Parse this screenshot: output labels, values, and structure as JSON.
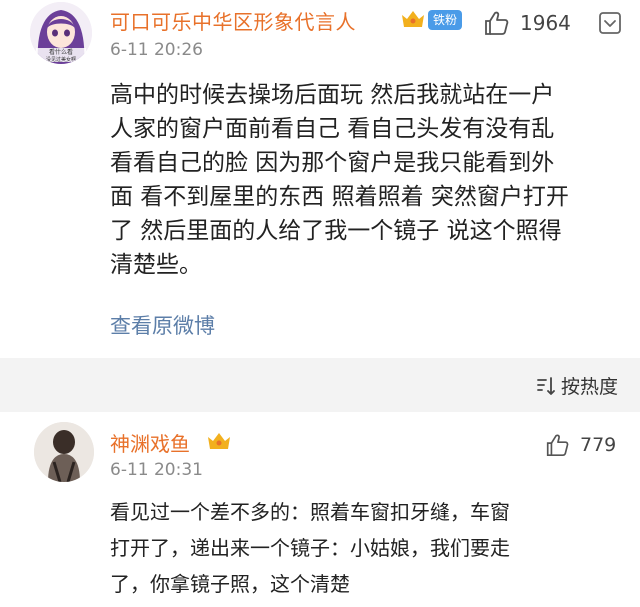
{
  "post": {
    "username": "可口可乐中华区形象代言人",
    "badge": "铁粉",
    "like_count": "1964",
    "time": "6-11 20:26",
    "avatar_text": [
      "看什么看",
      "没见过美女啊"
    ],
    "body_lines": [
      "高中的时候去操场后面玩 然后我就站在一户",
      "人家的窗户面前看自己 看自己头发有没有乱",
      "看看自己的脸 因为那个窗户是我只能看到外",
      "面 看不到屋里的东西 照着照着 突然窗户打开",
      "了 然后里面的人给了我一个镜子 说这个照得",
      "清楚些。"
    ],
    "view_original": "查看原微博"
  },
  "sort": {
    "label": "按热度"
  },
  "comment": {
    "username": "神渊戏鱼",
    "like_count": "779",
    "time": "6-11 20:31",
    "body_lines": [
      "看见过一个差不多的：照着车窗扣牙缝，车窗",
      "打开了，递出来一个镜子：小姑娘，我们要走",
      "了，你拿镜子照，这个清楚"
    ]
  },
  "colors": {
    "username": "#e8712a",
    "link": "#5c7ea8",
    "badge_bg": "#4a9be8",
    "crown": "#f2b01e",
    "divider_bg": "#f3f3f3"
  },
  "icons": [
    "thumbs-up-icon",
    "more-icon",
    "sort-icon",
    "vip-crown-icon"
  ]
}
